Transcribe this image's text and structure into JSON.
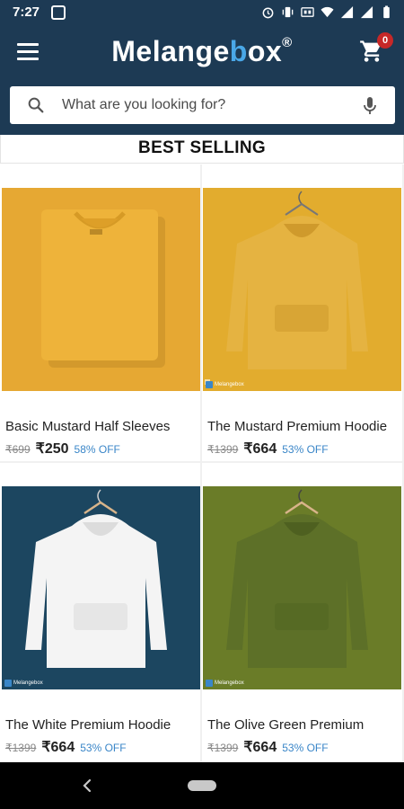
{
  "status_bar": {
    "time": "7:27"
  },
  "header": {
    "logo_part1": "Melange",
    "logo_part2": "b",
    "logo_part3": "ox",
    "logo_mark": "®",
    "cart_count": "0"
  },
  "search": {
    "placeholder": "What are you looking for?"
  },
  "section": {
    "title": "BEST SELLING"
  },
  "products": [
    {
      "name": "Basic Mustard Half Sleeves",
      "mrp": "₹699",
      "price": "₹250",
      "discount": "58% OFF",
      "color": "#e6a833",
      "type": "tshirt"
    },
    {
      "name": "The Mustard Premium Hoodie",
      "mrp": "₹1399",
      "price": "₹664",
      "discount": "53% OFF",
      "color": "#e2ac2e",
      "type": "hoodie"
    },
    {
      "name": "The White Premium Hoodie",
      "mrp": "₹1399",
      "price": "₹664",
      "discount": "53% OFF",
      "color": "#1c4660",
      "type": "hoodie"
    },
    {
      "name": "The Olive Green Premium",
      "mrp": "₹1399",
      "price": "₹664",
      "discount": "53% OFF",
      "color": "#6a7c28",
      "type": "hoodie"
    }
  ],
  "watermark_text": "Melangebox",
  "colors": {
    "header": "#1d3a54",
    "accent": "#4aa8e8",
    "badge": "#c62828",
    "discount": "#3a86c8"
  }
}
